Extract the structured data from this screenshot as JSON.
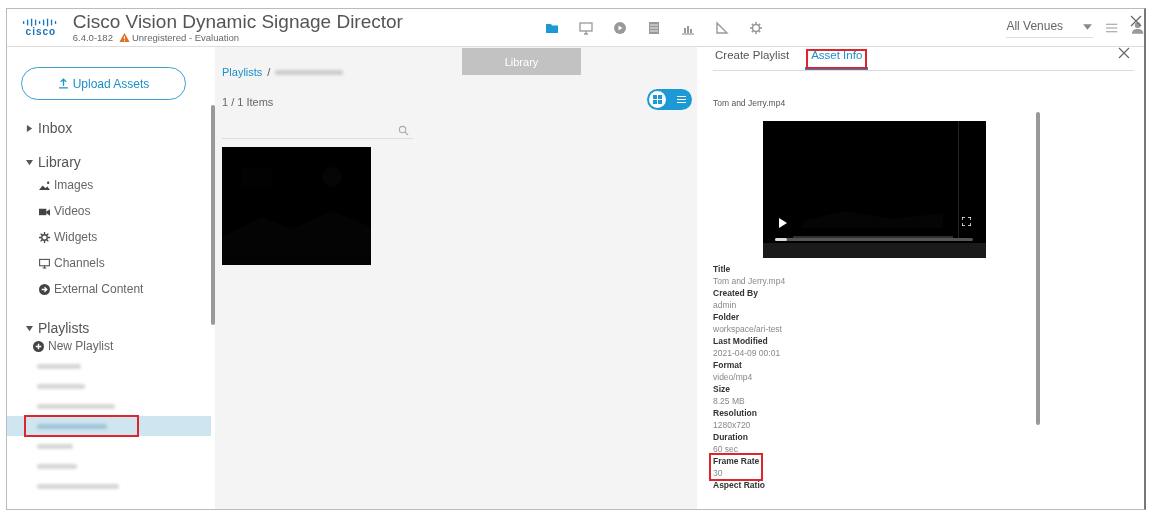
{
  "header": {
    "brand": "cisco",
    "title": "Cisco Vision Dynamic Signage Director",
    "version": "6.4.0-182",
    "warning": "Unregistered - Evaluation",
    "nav": [
      {
        "kind": "folder",
        "selected": true
      },
      {
        "kind": "monitor",
        "selected": false
      },
      {
        "kind": "play",
        "selected": false
      },
      {
        "kind": "list",
        "selected": false
      },
      {
        "kind": "chart",
        "selected": false
      },
      {
        "kind": "triangle",
        "selected": false
      },
      {
        "kind": "gear",
        "selected": false
      }
    ],
    "tooltip": "Library",
    "venue": "All Venues"
  },
  "sidebar": {
    "upload": "Upload Assets",
    "sections": [
      {
        "label": "Inbox",
        "expanded": false
      },
      {
        "label": "Library",
        "expanded": true,
        "items": [
          {
            "label": "Images"
          },
          {
            "kind": "video",
            "label": "Videos"
          },
          {
            "kind": "widget",
            "label": "Widgets"
          },
          {
            "kind": "channel",
            "label": "Channels"
          },
          {
            "kind": "external",
            "label": "External Content"
          }
        ]
      },
      {
        "label": "Playlists",
        "expanded": true,
        "items": [
          {
            "kind": "add",
            "label": "New Playlist"
          }
        ]
      }
    ],
    "playlists": [
      {
        "kind": "redacted",
        "selected": false,
        "annotated": false
      },
      {
        "kind": "redacted",
        "selected": false,
        "annotated": false
      },
      {
        "kind": "redacted",
        "selected": false,
        "annotated": false
      },
      {
        "kind": "redacted",
        "selected": true,
        "annotated": true
      },
      {
        "kind": "redacted",
        "selected": false,
        "annotated": false
      },
      {
        "kind": "redacted",
        "selected": false,
        "annotated": false
      },
      {
        "kind": "redacted",
        "selected": false,
        "annotated": false
      }
    ]
  },
  "content": {
    "breadcrumb": "Playlists",
    "separator": "/",
    "count": "1 / 1 Items",
    "view_toggle": [
      {
        "kind": "grid",
        "selected": true
      },
      {
        "kind": "list",
        "selected": false
      }
    ]
  },
  "panel": {
    "tabs": [
      {
        "label": "Create Playlist",
        "selected": false,
        "annotated": false
      },
      {
        "label": "Asset Info",
        "selected": true,
        "annotated": true
      }
    ],
    "filename": "Tom and Jerry.mp4",
    "fields": [
      {
        "label": "Title",
        "value": "Tom and Jerry.mp4",
        "annotated": false
      },
      {
        "label": "Created By",
        "value": "admin",
        "annotated": false
      },
      {
        "label": "Folder",
        "value": "workspace/ari-test",
        "annotated": false
      },
      {
        "label": "Last Modified",
        "value": "2021-04-09 00:01",
        "annotated": false
      },
      {
        "label": "Format",
        "value": "video/mp4",
        "annotated": false
      },
      {
        "label": "Size",
        "value": "8.25 MB",
        "annotated": false
      },
      {
        "label": "Resolution",
        "value": "1280x720",
        "annotated": false
      },
      {
        "label": "Duration",
        "value": "60 sec",
        "annotated": false
      },
      {
        "label": "Frame Rate",
        "value": "30",
        "annotated": true
      },
      {
        "label": "Aspect Ratio",
        "annotated": false
      }
    ]
  }
}
